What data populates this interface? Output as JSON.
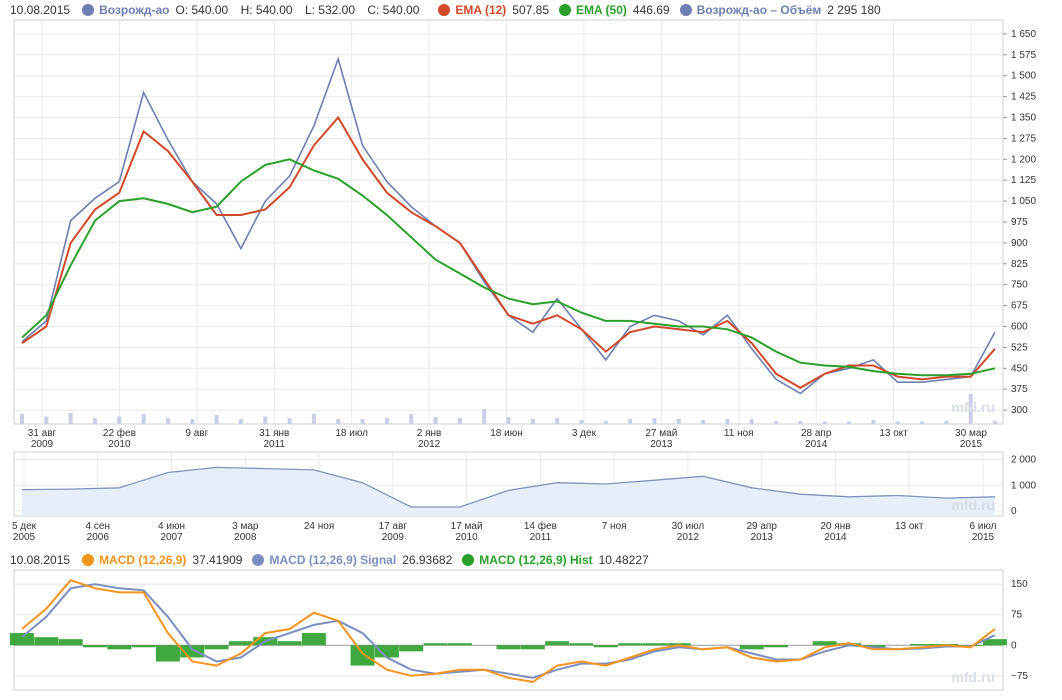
{
  "header": {
    "date": "10.08.2015",
    "ticker": "Возрожд-ао",
    "ohlc": {
      "open": "O: 540.00",
      "high": "H: 540.00",
      "low": "L: 532.00",
      "close": "C: 540.00"
    },
    "ema12_label": "EMA (12)",
    "ema12_value": "507.85",
    "ema50_label": "EMA (50)",
    "ema50_value": "446.69",
    "volume_label": "Возрожд-ао – Объём",
    "volume_value": "2 295 180"
  },
  "macd_header": {
    "date": "10.08.2015",
    "macd_label": "MACD (12,26,9)",
    "macd_value": "37.41909",
    "signal_label": "MACD (12,26,9) Signal",
    "signal_value": "26.93682",
    "hist_label": "MACD (12,26,9) Hist",
    "hist_value": "10.48227"
  },
  "watermark": "mfd.ru",
  "colors": {
    "price": "#6d7fb0",
    "ema12": "#d2492a",
    "ema50": "#2aa02a",
    "volume": "#c9cde6",
    "overview_line": "#7f93bd",
    "overview_fill": "#e6eefa",
    "macd": "#f7931e",
    "signal": "#7a8fbf",
    "hist": "#2aa02a",
    "grid": "#e8e8e8"
  },
  "chart_data": [
    {
      "type": "line",
      "name": "main",
      "x": [
        0,
        5,
        10,
        15,
        20,
        25,
        30,
        35,
        40,
        45,
        50,
        55,
        60,
        65,
        70,
        75,
        80,
        85,
        90,
        95,
        100,
        105,
        110,
        115,
        120,
        125,
        130,
        135,
        140,
        145,
        150,
        155,
        160,
        165,
        170,
        175,
        180,
        185,
        190,
        195,
        200
      ],
      "price": [
        545,
        620,
        980,
        1060,
        1120,
        1440,
        1270,
        1120,
        1040,
        880,
        1050,
        1140,
        1320,
        1560,
        1250,
        1120,
        1030,
        960,
        900,
        760,
        640,
        580,
        700,
        590,
        480,
        600,
        640,
        620,
        570,
        640,
        520,
        410,
        360,
        430,
        450,
        480,
        400,
        400,
        410,
        420,
        580
      ],
      "ema12": [
        540,
        600,
        900,
        1020,
        1080,
        1300,
        1230,
        1120,
        1000,
        1000,
        1020,
        1100,
        1250,
        1350,
        1200,
        1080,
        1010,
        960,
        900,
        770,
        640,
        610,
        640,
        590,
        510,
        580,
        600,
        590,
        580,
        620,
        540,
        430,
        380,
        430,
        460,
        460,
        420,
        410,
        420,
        420,
        520
      ],
      "ema50": [
        560,
        640,
        820,
        980,
        1050,
        1060,
        1040,
        1010,
        1030,
        1120,
        1180,
        1200,
        1160,
        1130,
        1070,
        1000,
        920,
        840,
        790,
        740,
        700,
        680,
        690,
        650,
        620,
        620,
        610,
        600,
        600,
        590,
        560,
        510,
        470,
        460,
        455,
        440,
        430,
        425,
        425,
        430,
        450
      ],
      "volume": [
        20,
        15,
        22,
        12,
        15,
        20,
        12,
        10,
        18,
        10,
        15,
        12,
        20,
        10,
        10,
        12,
        20,
        14,
        12,
        30,
        14,
        10,
        12,
        8,
        6,
        10,
        12,
        10,
        8,
        10,
        10,
        6,
        6,
        5,
        5,
        8,
        5,
        5,
        6,
        60,
        6
      ],
      "y_ticks": [
        300,
        375,
        450,
        525,
        600,
        675,
        750,
        825,
        900,
        975,
        1050,
        1125,
        1200,
        1275,
        1350,
        1425,
        1500,
        1575,
        1650
      ],
      "y_tick_labels": [
        "300",
        "375",
        "450",
        "525",
        "600",
        "675",
        "750",
        "825",
        "900",
        "975",
        "1 050",
        "1 125",
        "1 200",
        "1 275",
        "1 350",
        "1 425",
        "1 500",
        "1 575",
        "1 650"
      ],
      "ylim": [
        250,
        1700
      ],
      "x_tick_labels": [
        "31 авг",
        "22 фев",
        "9 авг",
        "31 янв",
        "18 июл",
        "2 янв",
        "18 июн",
        "3 дек",
        "27 май",
        "11 ноя",
        "28 апр",
        "13 окт",
        "30 мар"
      ],
      "x_year_labels": [
        "2009",
        "2010",
        "",
        "2011",
        "",
        "2012",
        "",
        "",
        "2013",
        "",
        "2014",
        "",
        "2015"
      ]
    },
    {
      "type": "area",
      "name": "overview",
      "x": [
        0,
        5,
        10,
        15,
        20,
        25,
        30,
        35,
        40,
        45,
        50,
        55,
        60,
        65,
        70,
        75,
        80,
        85,
        90,
        95,
        100
      ],
      "values": [
        830,
        850,
        900,
        1500,
        1700,
        1650,
        1600,
        1100,
        150,
        150,
        800,
        1100,
        1050,
        1200,
        1350,
        900,
        650,
        550,
        600,
        500,
        550
      ],
      "y_ticks": [
        0,
        1000,
        2000
      ],
      "y_tick_labels": [
        "0",
        "1 000",
        "2 000"
      ],
      "ylim": [
        -200,
        2300
      ],
      "x_tick_labels": [
        "5 дек",
        "4 сен",
        "4 июн",
        "3 мар",
        "24 ноя",
        "17 авг",
        "17 май",
        "14 фев",
        "7 ноя",
        "30 июл",
        "29 апр",
        "20 янв",
        "13 окт",
        "6 июл"
      ],
      "x_year_labels": [
        "2005",
        "2006",
        "2007",
        "2008",
        "",
        "2009",
        "2010",
        "2011",
        "",
        "2012",
        "2013",
        "2014",
        "",
        "2015"
      ]
    },
    {
      "type": "line",
      "name": "macd",
      "x": [
        0,
        5,
        10,
        15,
        20,
        25,
        30,
        35,
        40,
        45,
        50,
        55,
        60,
        65,
        70,
        75,
        80,
        85,
        90,
        95,
        100,
        105,
        110,
        115,
        120,
        125,
        130,
        135,
        140,
        145,
        150,
        155,
        160,
        165,
        170,
        175,
        180,
        185,
        190,
        195,
        200
      ],
      "macd": [
        40,
        90,
        160,
        140,
        130,
        130,
        30,
        -40,
        -50,
        -20,
        30,
        40,
        80,
        60,
        -20,
        -60,
        -75,
        -70,
        -60,
        -60,
        -80,
        -90,
        -50,
        -40,
        -50,
        -30,
        -10,
        0,
        -10,
        -5,
        -30,
        -40,
        -35,
        -5,
        5,
        -10,
        -10,
        -5,
        0,
        -5,
        40
      ],
      "signal": [
        20,
        70,
        140,
        150,
        140,
        135,
        70,
        -10,
        -40,
        -30,
        10,
        30,
        50,
        60,
        30,
        -30,
        -60,
        -70,
        -65,
        -60,
        -70,
        -80,
        -60,
        -45,
        -45,
        -35,
        -15,
        -5,
        -10,
        -5,
        -20,
        -35,
        -35,
        -15,
        0,
        -5,
        -10,
        -8,
        -3,
        -3,
        25
      ],
      "hist": [
        30,
        20,
        15,
        -5,
        -10,
        -5,
        -40,
        -30,
        -10,
        10,
        20,
        10,
        30,
        0,
        -50,
        -30,
        -15,
        5,
        5,
        0,
        -10,
        -10,
        10,
        5,
        -5,
        5,
        5,
        5,
        0,
        0,
        -10,
        -5,
        0,
        10,
        5,
        -5,
        0,
        3,
        3,
        -2,
        15
      ],
      "y_ticks": [
        -75,
        0,
        75,
        150
      ],
      "y_tick_labels": [
        "−75",
        "0",
        "75",
        "150"
      ],
      "ylim": [
        -110,
        185
      ]
    }
  ]
}
